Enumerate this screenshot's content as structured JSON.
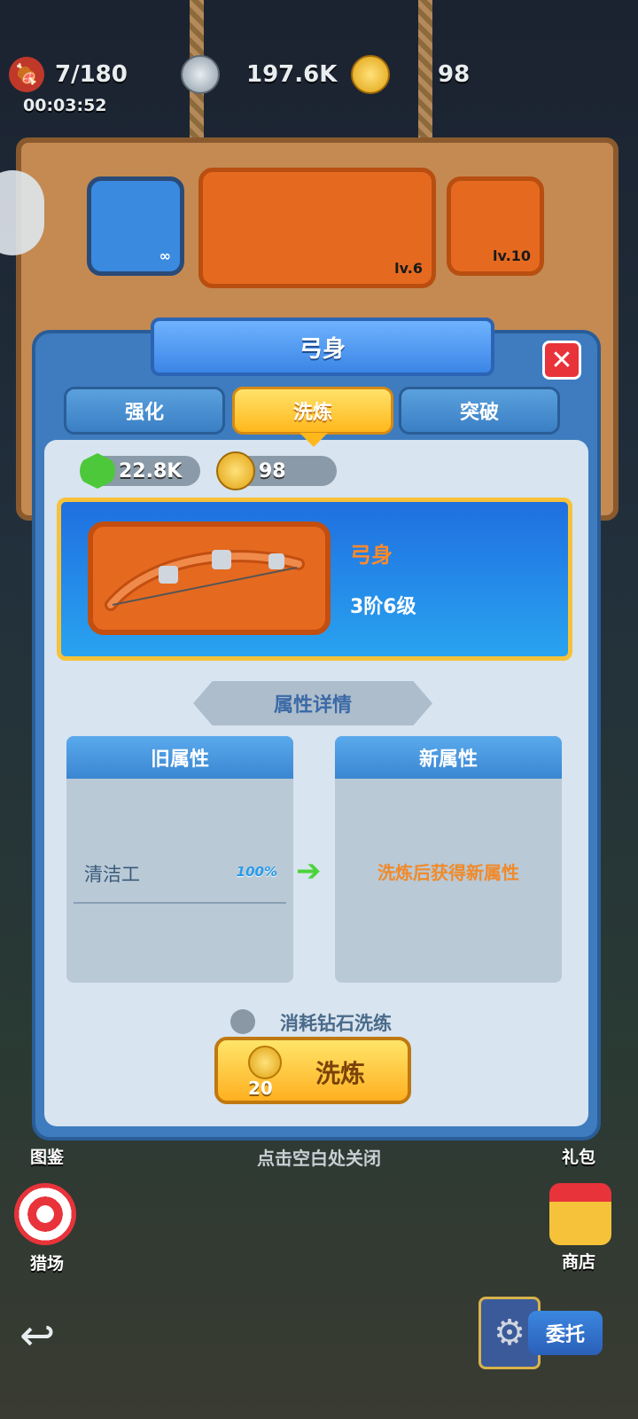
{
  "top_bar": {
    "meat": {
      "icon": "meat-icon",
      "value": "7/180"
    },
    "silver": {
      "icon": "silver-coin-icon",
      "value": "197.6K"
    },
    "gold": {
      "icon": "gold-coin-icon",
      "value": "98"
    },
    "timer": "00:03:52"
  },
  "background_board": {
    "slot_meat_count": "∞",
    "slot_bow_level": "lv.6",
    "slot_string_level": "lv.10"
  },
  "panel": {
    "title": "弓身",
    "tabs": [
      {
        "label": "强化",
        "active": false
      },
      {
        "label": "洗炼",
        "active": true
      },
      {
        "label": "突破",
        "active": false
      }
    ],
    "currencies": [
      {
        "icon": "green-gem-icon",
        "value": "22.8K"
      },
      {
        "icon": "gold-coin-icon",
        "value": "98"
      }
    ],
    "item": {
      "name": "弓身",
      "level": "3阶6级"
    },
    "section_title": "属性详情",
    "old_attr": {
      "header": "旧属性",
      "name": "清洁工",
      "percent": "100%"
    },
    "new_attr": {
      "header": "新属性",
      "hint": "洗炼后获得新属性"
    },
    "diamond_option": "消耗钻石洗练",
    "refine_button": {
      "cost": "20",
      "label": "洗炼"
    }
  },
  "tap_to_close": "点击空白处关闭",
  "side": {
    "left_top_label": "图鉴",
    "left_bottom_label": "猎场",
    "right_top_label": "礼包",
    "right_bottom_label": "商店"
  },
  "bottom": {
    "commission_label": "委托"
  },
  "colors": {
    "panel_blue": "#3e7cbf",
    "tab_active": "#ffb81c",
    "item_card_border": "#f6c23a",
    "new_attr_hint": "#f08a2a",
    "percent_blue": "#2a9be8"
  }
}
